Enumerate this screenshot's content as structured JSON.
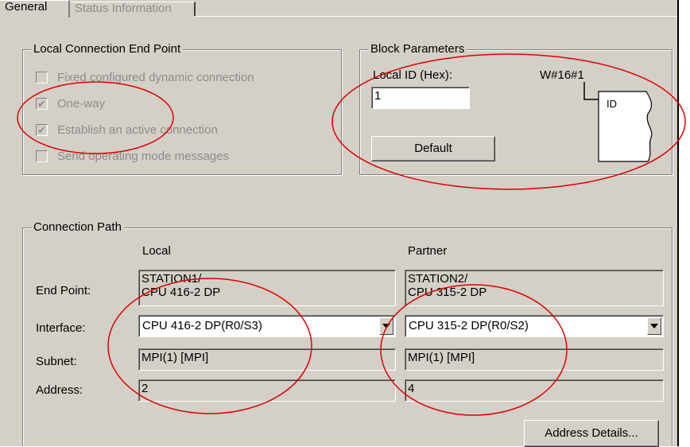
{
  "tabs": [
    {
      "label": "General",
      "active": true
    },
    {
      "label": "Status Information",
      "active": false
    }
  ],
  "local_endpoint": {
    "title": "Local Connection End Point",
    "checkboxes": [
      {
        "label": "Fixed configured dynamic connection",
        "checked": false,
        "enabled": false
      },
      {
        "label": "One-way",
        "checked": true,
        "enabled": false
      },
      {
        "label": "Establish an active connection",
        "checked": true,
        "enabled": false
      },
      {
        "label": "Send operating mode messages",
        "checked": false,
        "enabled": false
      }
    ]
  },
  "block_params": {
    "title": "Block Parameters",
    "local_id_label": "Local ID (Hex):",
    "local_id_value": "1",
    "w_value": "W#16#1",
    "id_label": "ID",
    "default_button": "Default"
  },
  "connection_path": {
    "title": "Connection Path",
    "col_local": "Local",
    "col_partner": "Partner",
    "rows": {
      "end_point": "End Point:",
      "interface": "Interface:",
      "subnet": "Subnet:",
      "address": "Address:"
    },
    "local": {
      "end_point": "STATION1/\nCPU 416-2 DP",
      "interface": "CPU 416-2 DP(R0/S3)",
      "subnet": "MPI(1) [MPI]",
      "address": "2"
    },
    "partner": {
      "end_point": "STATION2/\nCPU 315-2 DP",
      "interface": "CPU 315-2 DP(R0/S2)",
      "subnet": "MPI(1) [MPI]",
      "address": "4"
    },
    "address_details_button": "Address Details..."
  },
  "colors": {
    "dialog_bg": "#d4d0c8",
    "annotation_red": "#e00000",
    "disabled_text": "#8c8c8c"
  }
}
